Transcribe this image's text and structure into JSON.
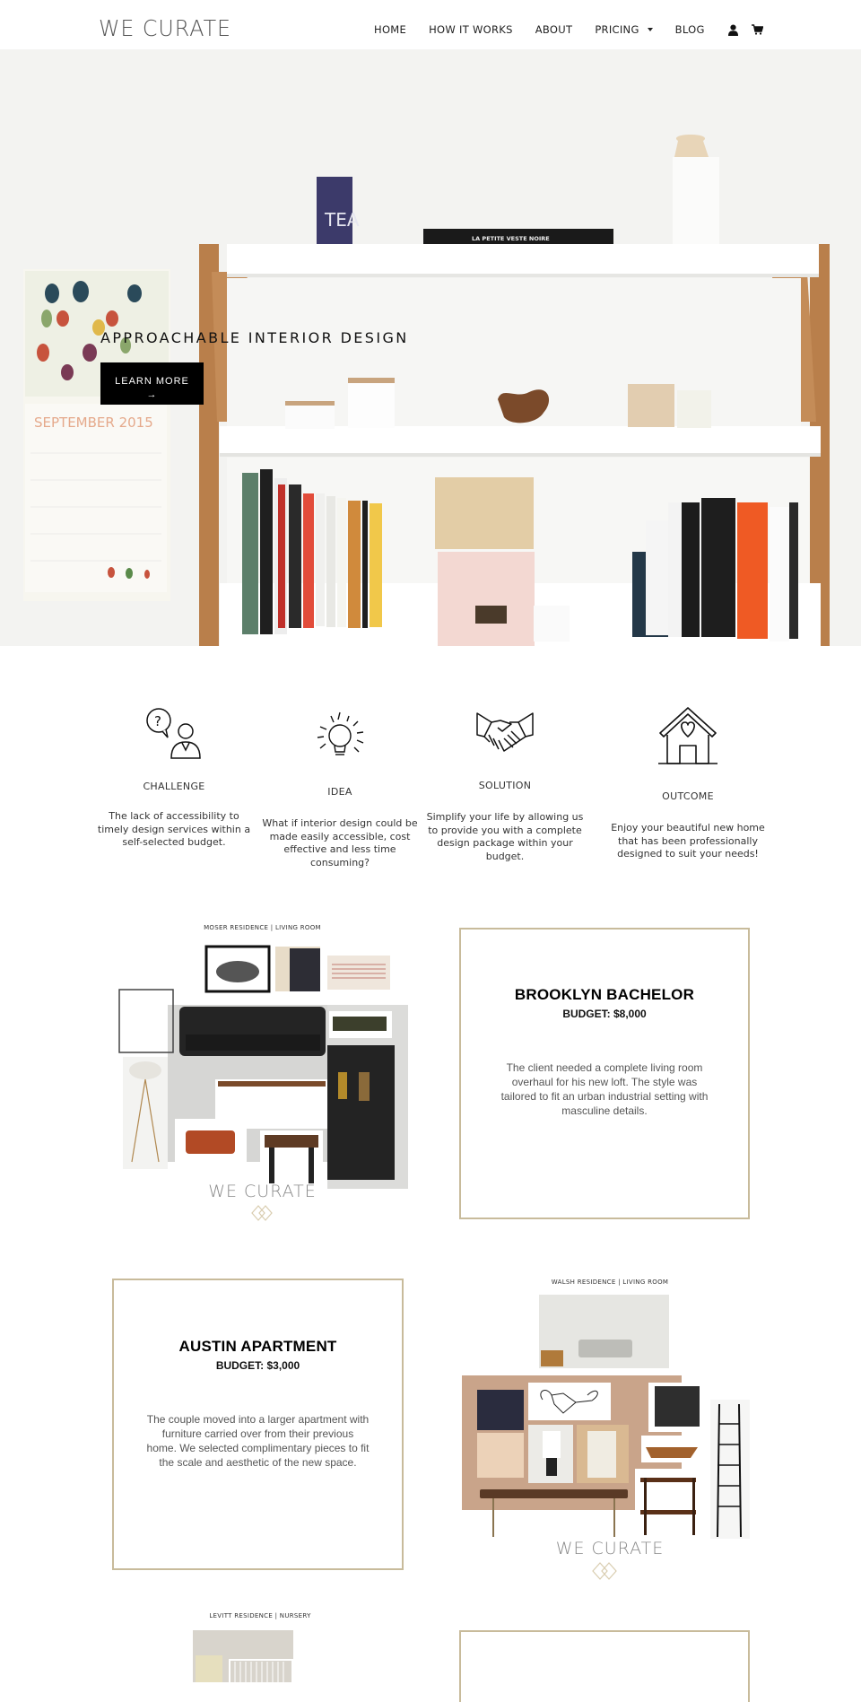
{
  "header": {
    "logo": "WE CURATE",
    "nav": [
      {
        "label": "HOME"
      },
      {
        "label": "HOW IT WORKS"
      },
      {
        "label": "ABOUT"
      },
      {
        "label": "PRICING",
        "has_dropdown": true
      },
      {
        "label": "BLOG"
      }
    ],
    "icons": [
      "account-icon",
      "cart-icon"
    ]
  },
  "hero": {
    "title": "APPROACHABLE INTERIOR DESIGN",
    "button_label": "LEARN MORE",
    "button_arrow": "→",
    "calendar_text": "SEPTEMBER 2015",
    "book_title": "LA PETITE VESTE NOIRE",
    "tin_label": "TEA"
  },
  "process": [
    {
      "icon": "question-person-icon",
      "label": "CHALLENGE",
      "text": "The lack of accessibility to timely design services within a self-selected budget."
    },
    {
      "icon": "lightbulb-icon",
      "label": "IDEA",
      "text": "What if interior design could be made easily accessible, cost effective and less time consuming?"
    },
    {
      "icon": "handshake-icon",
      "label": "SOLUTION",
      "text": "Simplify your life by allowing us to provide you with a complete design package within your budget."
    },
    {
      "icon": "house-heart-icon",
      "label": "OUTCOME",
      "text": "Enjoy your beautiful new home that has been professionally designed to suit your needs!"
    }
  ],
  "projects": [
    {
      "board_caption": "MOSER RESIDENCE  |   LIVING ROOM",
      "board_watermark": "WE CURATE",
      "title": "BROOKLYN BACHELOR",
      "budget": "BUDGET: $8,000",
      "text": "The client needed a complete living room overhaul for his new loft.  The style was tailored to fit an urban industrial setting with masculine details."
    },
    {
      "board_caption": "WALSH RESIDENCE  |   LIVING ROOM",
      "board_watermark": "WE CURATE",
      "title": "AUSTIN APARTMENT",
      "budget": "BUDGET: $3,000",
      "text": "The couple moved into a larger apartment with furniture carried over from their previous home.  We selected complimentary pieces to fit the scale and aesthetic of the new space."
    },
    {
      "board_caption": "LEVITT RESIDENCE  |  NURSERY"
    }
  ],
  "colors": {
    "card_border": "#c8bb9b",
    "button_bg": "#000000",
    "text": "#222222"
  }
}
